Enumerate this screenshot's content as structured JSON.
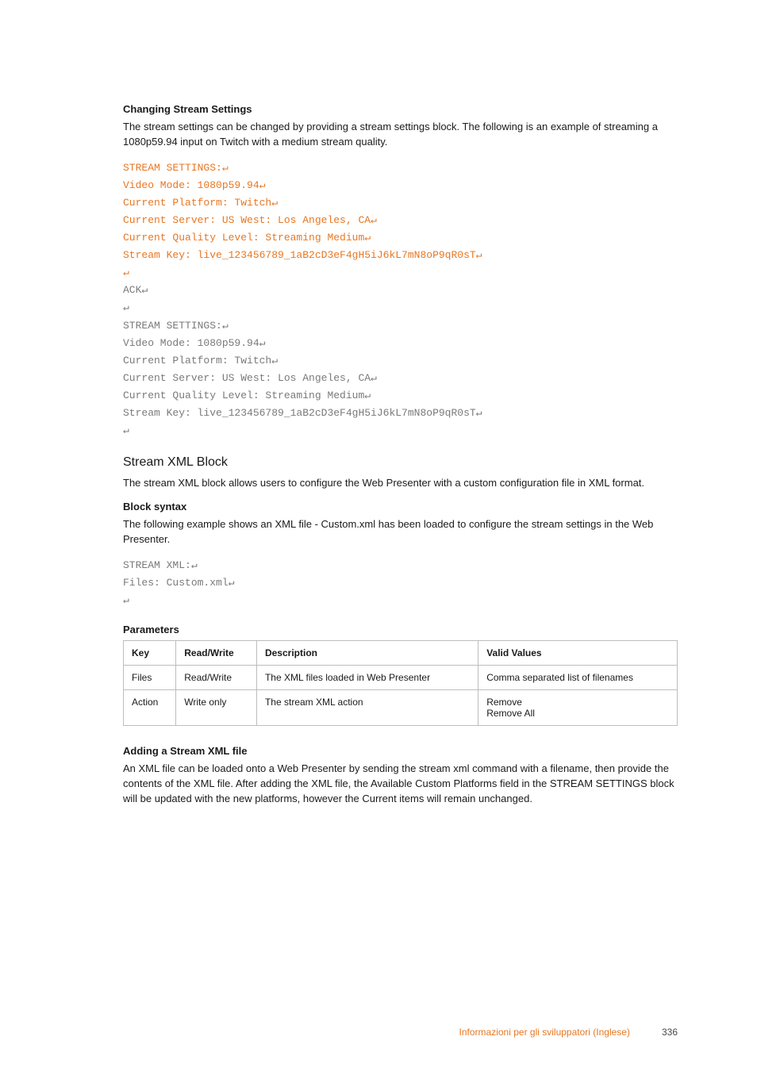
{
  "section1": {
    "heading": "Changing Stream Settings",
    "paragraph": "The stream settings can be changed by providing a stream settings block. The following is an example of streaming a 1080p59.94 input on Twitch with a medium stream quality.",
    "code_orange": "STREAM SETTINGS:↵\nVideo Mode: 1080p59.94↵\nCurrent Platform: Twitch↵\nCurrent Server: US West: Los Angeles, CA↵\nCurrent Quality Level: Streaming Medium↵\nStream Key: live_123456789_1aB2cD3eF4gH5iJ6kL7mN8oP9qR0sT↵\n↵",
    "code_grey": "ACK↵\n↵\nSTREAM SETTINGS:↵\nVideo Mode: 1080p59.94↵\nCurrent Platform: Twitch↵\nCurrent Server: US West: Los Angeles, CA↵\nCurrent Quality Level: Streaming Medium↵\nStream Key: live_123456789_1aB2cD3eF4gH5iJ6kL7mN8oP9qR0sT↵\n↵"
  },
  "section2": {
    "heading": "Stream XML Block",
    "paragraph": "The stream XML block allows users to configure the Web Presenter with a custom configuration file in XML format."
  },
  "section3": {
    "heading": "Block syntax",
    "paragraph": "The following example shows an XML file - Custom.xml has been loaded to configure the stream settings in the Web Presenter.",
    "code_grey": "STREAM XML:↵\nFiles: Custom.xml↵\n↵"
  },
  "section4": {
    "heading": "Parameters",
    "table": {
      "headers": [
        "Key",
        "Read/Write",
        "Description",
        "Valid Values"
      ],
      "rows": [
        [
          "Files",
          "Read/Write",
          "The XML files loaded in Web Presenter",
          "Comma separated list of filenames"
        ],
        [
          "Action",
          "Write only",
          "The stream XML action",
          "Remove\nRemove All"
        ]
      ]
    }
  },
  "section5": {
    "heading": "Adding a Stream XML file",
    "paragraph": "An XML file can be loaded onto a Web Presenter by sending the stream xml command with a filename, then provide the contents of the XML file. After adding the XML file, the Available Custom Platforms field in the STREAM SETTINGS block will be updated with the new platforms, however the Current items will remain unchanged."
  },
  "footer": {
    "section": "Informazioni per gli sviluppatori (Inglese)",
    "page": "336"
  }
}
